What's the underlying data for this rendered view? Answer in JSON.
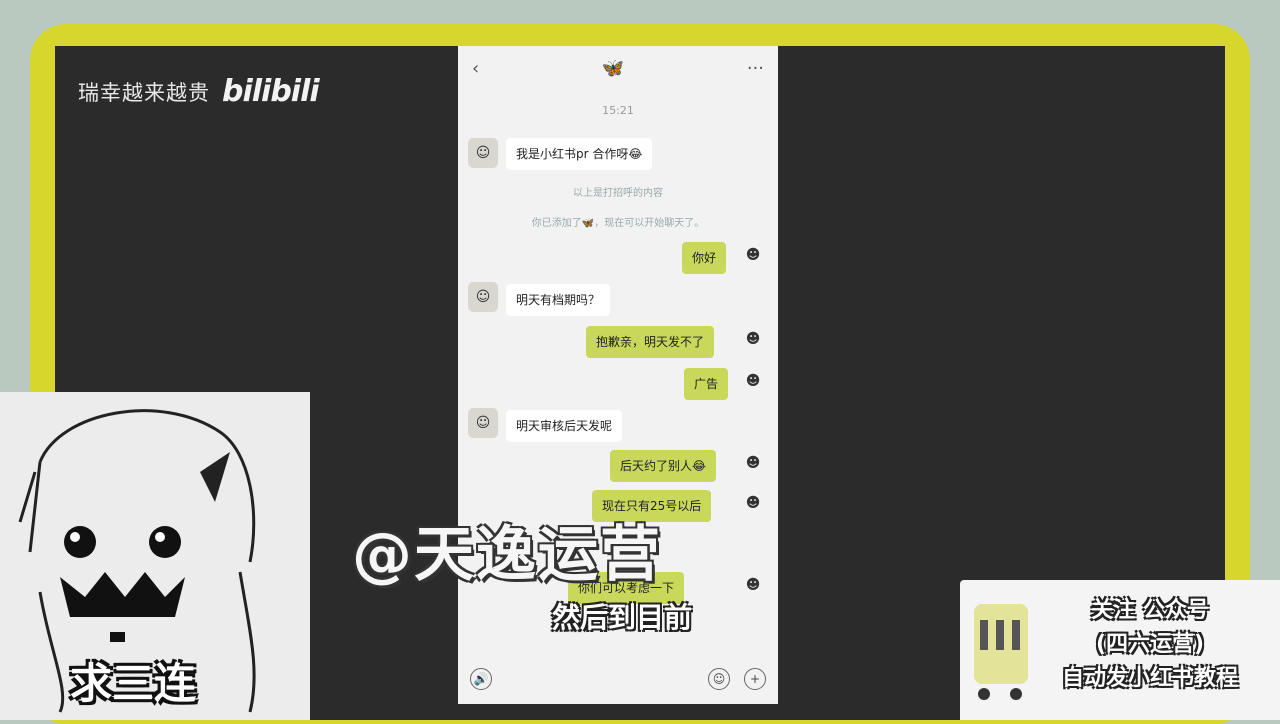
{
  "header": {
    "title": "瑞幸越来越贵",
    "logo_text": "bilibili"
  },
  "phone": {
    "back_icon": "‹",
    "contact_icon": "🦋",
    "more_icon": "···",
    "time": "15:21",
    "system_notes": [
      "以上是打招呼的内容",
      "你已添加了🦋，现在可以开始聊天了。"
    ],
    "messages": [
      {
        "side": "left",
        "text": "我是小红书pr 合作呀😂"
      },
      {
        "side": "right",
        "text": "你好"
      },
      {
        "side": "left",
        "text": "明天有档期吗？"
      },
      {
        "side": "right",
        "text": "抱歉亲，明天发不了"
      },
      {
        "side": "right",
        "text": "广告"
      },
      {
        "side": "left",
        "text": "明天审核后天发呢"
      },
      {
        "side": "right",
        "text": "后天约了别人😂"
      },
      {
        "side": "right",
        "text": "现在只有25号以后"
      },
      {
        "side": "right",
        "text": "你们可以考虑一下"
      }
    ],
    "bottom": {
      "voice_icon": "🔊",
      "emoji_icon": "☺",
      "plus_icon": "+"
    }
  },
  "overlay": {
    "watermark": "@天逸运营",
    "subtitle": "然后到目前"
  },
  "sticker": {
    "caption": "求三连"
  },
  "promo": {
    "lines": [
      "关注 公众号",
      "(四六运营)",
      "自动发小红书教程"
    ]
  },
  "colors": {
    "frame": "#d6d62c",
    "dark": "#2b2b2b",
    "bubble_right": "#c9d85a"
  }
}
